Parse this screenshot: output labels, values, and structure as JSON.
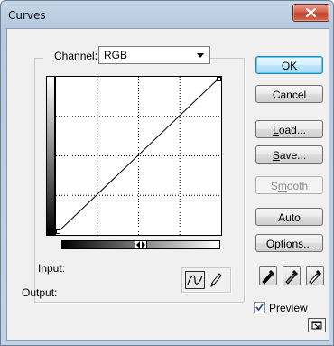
{
  "window": {
    "title": "Curves"
  },
  "channel": {
    "label_prefix": "",
    "label_mnemonic": "C",
    "label_rest": "hannel:",
    "value": "RGB"
  },
  "buttons": {
    "ok": "OK",
    "cancel": "Cancel",
    "load_mnemonic": "L",
    "load_rest": "oad...",
    "save_mnemonic": "S",
    "save_rest": "ave...",
    "smooth_pre": "S",
    "smooth_mnemonic": "m",
    "smooth_rest": "ooth",
    "auto": "Auto",
    "options": "Options..."
  },
  "io": {
    "input_label": "Input:",
    "output_label": "Output:"
  },
  "preview": {
    "mnemonic": "P",
    "rest": "review",
    "checked": true
  },
  "icons": [
    "close-icon",
    "dropdown-arrow-icon",
    "curve-tool-icon",
    "pencil-tool-icon",
    "black-eyedropper-icon",
    "gray-eyedropper-icon",
    "white-eyedropper-icon",
    "expand-icon",
    "gradient-toggle-icon"
  ]
}
